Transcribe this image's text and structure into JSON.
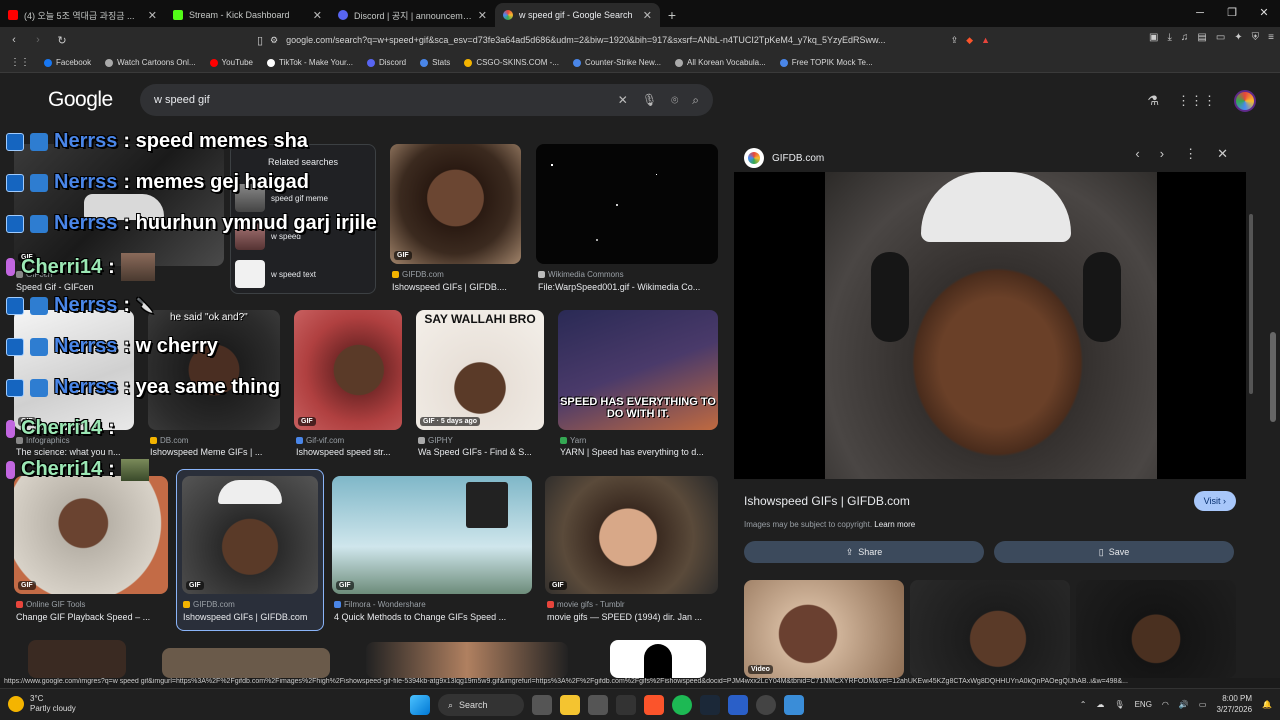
{
  "tabs": [
    {
      "label": "(4) 오늘 5조 역대급 과징금 ...",
      "color": "#ff0000",
      "active": false
    },
    {
      "label": "Stream - Kick Dashboard",
      "color": "#53fc18",
      "active": false
    },
    {
      "label": "Discord | 공지 | announcement",
      "color": "#5865f2",
      "active": false
    },
    {
      "label": "w speed gif - Google Search",
      "color": "#ffffff",
      "active": true
    }
  ],
  "url": "google.com/search?q=w+speed+gif&sca_esv=d73fe3a64ad5d686&udm=2&biw=1920&bih=917&sxsrf=ANbL-n4TUCI2TpKeM4_y7kq_5YzyEdRSww...",
  "bookmarks": [
    {
      "label": "Facebook",
      "color": "#1877f2"
    },
    {
      "label": "Watch Cartoons Onl...",
      "color": "#aaaaaa"
    },
    {
      "label": "YouTube",
      "color": "#ff0000"
    },
    {
      "label": "TikTok - Make Your...",
      "color": "#ffffff"
    },
    {
      "label": "Discord",
      "color": "#5865f2"
    },
    {
      "label": "Stats",
      "color": "#4a86e8"
    },
    {
      "label": "CSGO-SKINS.COM -...",
      "color": "#f4b400"
    },
    {
      "label": "Counter-Strike New...",
      "color": "#4a86e8"
    },
    {
      "label": "All Korean Vocabula...",
      "color": "#aaaaaa"
    },
    {
      "label": "Free TOPIK Mock Te...",
      "color": "#4a86e8"
    }
  ],
  "logo": "Google",
  "search": {
    "query": "w speed gif"
  },
  "related": {
    "heading": "Related searches",
    "items": [
      "speed gif meme",
      "w speed",
      "w speed text"
    ]
  },
  "results": [
    {
      "badge": "GIF",
      "source": "GIFcen",
      "title": "Speed Gif - GIFcen",
      "scolor": "#888"
    },
    {
      "badge": "GIF",
      "source": "GIFDB.com",
      "title": "Ishowspeed GIFs | GIFDB....",
      "scolor": "#f4b400"
    },
    {
      "badge": "",
      "source": "Wikimedia Commons",
      "title": "File:WarpSpeed001.gif - Wikimedia Co...",
      "scolor": "#bbb"
    },
    {
      "badge": "GIF",
      "source": "Infographics",
      "title": "The science: what you n...",
      "scolor": "#888"
    },
    {
      "badge": "",
      "source": "DB.com",
      "title": "Ishowspeed Meme GIFs | ...",
      "scolor": "#f4b400"
    },
    {
      "badge": "GIF",
      "source": "Gif-vif.com",
      "title": "Ishowspeed speed str...",
      "scolor": "#4a86e8"
    },
    {
      "badge": "GIF · 5 days ago",
      "source": "GIPHY",
      "title": "Wa Speed GIFs - Find & S...",
      "scolor": "#aaa"
    },
    {
      "badge": "",
      "source": "Yarn",
      "title": "YARN | Speed has everything to d...",
      "scolor": "#34a853"
    },
    {
      "badge": "GIF",
      "source": "Online GIF Tools",
      "title": "Change GIF Playback Speed – ...",
      "scolor": "#e8453c"
    },
    {
      "badge": "GIF",
      "source": "GIFDB.com",
      "title": "Ishowspeed GIFs | GIFDB.com",
      "scolor": "#f4b400"
    },
    {
      "badge": "GIF",
      "source": "Filmora - Wondershare",
      "title": "4 Quick Methods to Change GIFs Speed ...",
      "scolor": "#4a86e8"
    },
    {
      "badge": "GIF",
      "source": "movie gifs - Tumblr",
      "title": "movie gifs — SPEED (1994) dir. Jan ...",
      "scolor": "#e8453c"
    }
  ],
  "captions": {
    "wallahi": "SAY WALLAHI BRO",
    "speed_has": "SPEED HAS EVERYTHING TO DO WITH IT.",
    "ok_and": "he said \"ok and?\""
  },
  "chat": [
    {
      "user": "Nerrss",
      "message": ": speed memes sha"
    },
    {
      "user": "Nerrss",
      "message": ": memes gej haigad"
    },
    {
      "user": "Nerrss",
      "message": ": huurhun ymnud garj irjile"
    },
    {
      "user": "Cherri14",
      "message": ":"
    },
    {
      "user": "Nerrss",
      "message": ":"
    },
    {
      "user": "Nerrss",
      "message": ": w cherry"
    },
    {
      "user": "Nerrss",
      "message": ": yea same thing"
    },
    {
      "user": "Cherri14",
      "message": ":"
    },
    {
      "user": "Cherri14",
      "message": ":"
    }
  ],
  "panel": {
    "site": "GIFDB.com",
    "title": "Ishowspeed GIFs | GIFDB.com",
    "visit": "Visit",
    "copyright": "Images may be subject to copyright.",
    "learn_more": "Learn more",
    "share": "Share",
    "save": "Save",
    "thumb_badge": "Video"
  },
  "status_url": "https://www.google.com/imgres?q=w speed gif&imgurl=https%3A%2F%2Fgifdb.com%2Fimages%2Fhigh%2Fishowspeed-gif-file-5394kb-atg9x13lqg19m5w9.gif&imgrefurl=https%3A%2F%2Fgifdb.com%2Fgifs%2Fishowspeed&docid=PJM4wxx2LcY04M&tbnid=C71NMCXYRFODM&vet=12ahUKEwi45KZg8CTAxWg8DQHHUYnA0kQnPAOegQIJhAB..i&w=498&...",
  "taskbar": {
    "temp": "3°C",
    "weather": "Partly cloudy",
    "search": "Search",
    "lang": "ENG",
    "time": "8:00 PM",
    "date": "3/27/2026"
  }
}
